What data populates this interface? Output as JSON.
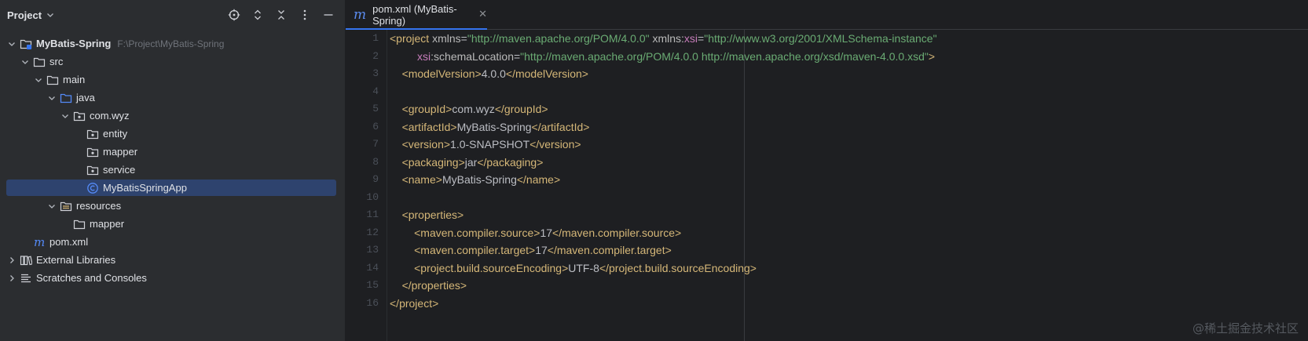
{
  "project_panel": {
    "title": "Project",
    "tree": [
      {
        "label": "MyBatis-Spring",
        "path": "F:\\Project\\MyBatis-Spring",
        "depth": 0,
        "expanded": true,
        "icon": "module-icon",
        "bold": true
      },
      {
        "label": "src",
        "depth": 1,
        "expanded": true,
        "icon": "folder-icon"
      },
      {
        "label": "main",
        "depth": 2,
        "expanded": true,
        "icon": "folder-icon"
      },
      {
        "label": "java",
        "depth": 3,
        "expanded": true,
        "icon": "source-folder-icon"
      },
      {
        "label": "com.wyz",
        "depth": 4,
        "expanded": true,
        "icon": "package-icon"
      },
      {
        "label": "entity",
        "depth": 5,
        "icon": "package-icon"
      },
      {
        "label": "mapper",
        "depth": 5,
        "icon": "package-icon"
      },
      {
        "label": "service",
        "depth": 5,
        "icon": "package-icon"
      },
      {
        "label": "MyBatisSpringApp",
        "depth": 5,
        "icon": "class-icon",
        "selected": true
      },
      {
        "label": "resources",
        "depth": 3,
        "expanded": true,
        "icon": "resources-folder-icon"
      },
      {
        "label": "mapper",
        "depth": 4,
        "icon": "folder-icon"
      },
      {
        "label": "pom.xml",
        "depth": 1,
        "icon": "maven-icon"
      },
      {
        "label": "External Libraries",
        "depth": 0,
        "expanded": false,
        "icon": "libraries-icon"
      },
      {
        "label": "Scratches and Consoles",
        "depth": 0,
        "expanded": false,
        "icon": "scratches-icon"
      }
    ]
  },
  "editor": {
    "tab": {
      "icon_glyph": "m",
      "label": "pom.xml (MyBatis-Spring)",
      "close": "✕"
    },
    "line_numbers": [
      "1",
      "2",
      "3",
      "4",
      "5",
      "6",
      "7",
      "8",
      "9",
      "10",
      "11",
      "12",
      "13",
      "14",
      "15",
      "16"
    ],
    "lines": [
      [
        {
          "c": "tg",
          "t": "<project "
        },
        {
          "c": "an",
          "t": "xmlns"
        },
        {
          "c": "tx",
          "t": "="
        },
        {
          "c": "av",
          "t": "\"http://maven.apache.org/POM/4.0.0\""
        },
        {
          "c": "tx",
          "t": " "
        },
        {
          "c": "an",
          "t": "xmlns:"
        },
        {
          "c": "ns",
          "t": "xsi"
        },
        {
          "c": "tx",
          "t": "="
        },
        {
          "c": "av",
          "t": "\"http://www.w3.org/2001/XMLSchema-instance\""
        }
      ],
      [
        {
          "c": "tx",
          "t": "         "
        },
        {
          "c": "ns",
          "t": "xsi"
        },
        {
          "c": "an",
          "t": ":schemaLocation"
        },
        {
          "c": "tx",
          "t": "="
        },
        {
          "c": "av",
          "t": "\"http://maven.apache.org/POM/4.0.0 http://maven.apache.org/xsd/maven-4.0.0.xsd\""
        },
        {
          "c": "tg",
          "t": ">"
        }
      ],
      [
        {
          "c": "tx",
          "t": "    "
        },
        {
          "c": "tg",
          "t": "<modelVersion>"
        },
        {
          "c": "tx",
          "t": "4.0.0"
        },
        {
          "c": "tg",
          "t": "</modelVersion>"
        }
      ],
      [],
      [
        {
          "c": "tx",
          "t": "    "
        },
        {
          "c": "tg",
          "t": "<groupId>"
        },
        {
          "c": "tx",
          "t": "com.wyz"
        },
        {
          "c": "tg",
          "t": "</groupId>"
        }
      ],
      [
        {
          "c": "tx",
          "t": "    "
        },
        {
          "c": "tg",
          "t": "<artifactId>"
        },
        {
          "c": "tx",
          "t": "MyBatis-Spring"
        },
        {
          "c": "tg",
          "t": "</artifactId>"
        }
      ],
      [
        {
          "c": "tx",
          "t": "    "
        },
        {
          "c": "tg",
          "t": "<version>"
        },
        {
          "c": "tx",
          "t": "1.0-SNAPSHOT"
        },
        {
          "c": "tg",
          "t": "</version>"
        }
      ],
      [
        {
          "c": "tx",
          "t": "    "
        },
        {
          "c": "tg",
          "t": "<packaging>"
        },
        {
          "c": "tx",
          "t": "jar"
        },
        {
          "c": "tg",
          "t": "</packaging>"
        }
      ],
      [
        {
          "c": "tx",
          "t": "    "
        },
        {
          "c": "tg",
          "t": "<name>"
        },
        {
          "c": "tx",
          "t": "MyBatis-Spring"
        },
        {
          "c": "tg",
          "t": "</name>"
        }
      ],
      [],
      [
        {
          "c": "tx",
          "t": "    "
        },
        {
          "c": "tg",
          "t": "<properties>"
        }
      ],
      [
        {
          "c": "tx",
          "t": "        "
        },
        {
          "c": "tg",
          "t": "<maven.compiler.source>"
        },
        {
          "c": "tx",
          "t": "17"
        },
        {
          "c": "tg",
          "t": "</maven.compiler.source>"
        }
      ],
      [
        {
          "c": "tx",
          "t": "        "
        },
        {
          "c": "tg",
          "t": "<maven.compiler.target>"
        },
        {
          "c": "tx",
          "t": "17"
        },
        {
          "c": "tg",
          "t": "</maven.compiler.target>"
        }
      ],
      [
        {
          "c": "tx",
          "t": "        "
        },
        {
          "c": "tg",
          "t": "<project.build.sourceEncoding>"
        },
        {
          "c": "tx",
          "t": "UTF-8"
        },
        {
          "c": "tg",
          "t": "</project.build.sourceEncoding>"
        }
      ],
      [
        {
          "c": "tx",
          "t": "    "
        },
        {
          "c": "tg",
          "t": "</properties>"
        }
      ],
      [
        {
          "c": "tg",
          "t": "</project>"
        }
      ]
    ]
  },
  "watermark": "@稀土掘金技术社区",
  "colors": {
    "accent": "#3574f0",
    "selection": "#2e436e",
    "tag": "#d5b778",
    "attr_value": "#6aab73",
    "namespace": "#c77dbb"
  }
}
